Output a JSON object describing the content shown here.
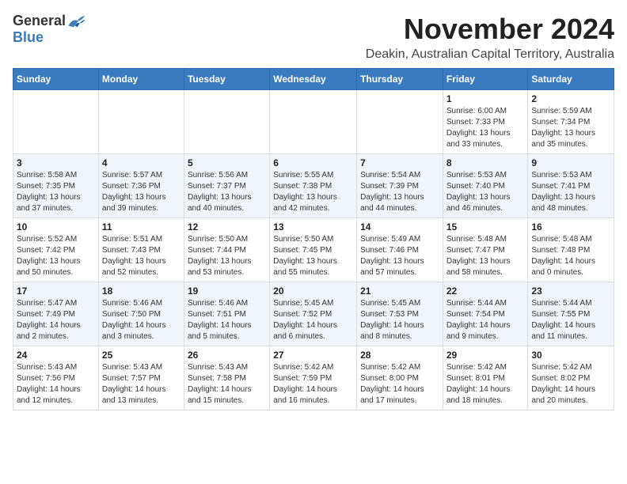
{
  "logo": {
    "general": "General",
    "blue": "Blue"
  },
  "title": "November 2024",
  "location": "Deakin, Australian Capital Territory, Australia",
  "days_header": [
    "Sunday",
    "Monday",
    "Tuesday",
    "Wednesday",
    "Thursday",
    "Friday",
    "Saturday"
  ],
  "weeks": [
    [
      {
        "day": "",
        "info": ""
      },
      {
        "day": "",
        "info": ""
      },
      {
        "day": "",
        "info": ""
      },
      {
        "day": "",
        "info": ""
      },
      {
        "day": "",
        "info": ""
      },
      {
        "day": "1",
        "info": "Sunrise: 6:00 AM\nSunset: 7:33 PM\nDaylight: 13 hours\nand 33 minutes."
      },
      {
        "day": "2",
        "info": "Sunrise: 5:59 AM\nSunset: 7:34 PM\nDaylight: 13 hours\nand 35 minutes."
      }
    ],
    [
      {
        "day": "3",
        "info": "Sunrise: 5:58 AM\nSunset: 7:35 PM\nDaylight: 13 hours\nand 37 minutes."
      },
      {
        "day": "4",
        "info": "Sunrise: 5:57 AM\nSunset: 7:36 PM\nDaylight: 13 hours\nand 39 minutes."
      },
      {
        "day": "5",
        "info": "Sunrise: 5:56 AM\nSunset: 7:37 PM\nDaylight: 13 hours\nand 40 minutes."
      },
      {
        "day": "6",
        "info": "Sunrise: 5:55 AM\nSunset: 7:38 PM\nDaylight: 13 hours\nand 42 minutes."
      },
      {
        "day": "7",
        "info": "Sunrise: 5:54 AM\nSunset: 7:39 PM\nDaylight: 13 hours\nand 44 minutes."
      },
      {
        "day": "8",
        "info": "Sunrise: 5:53 AM\nSunset: 7:40 PM\nDaylight: 13 hours\nand 46 minutes."
      },
      {
        "day": "9",
        "info": "Sunrise: 5:53 AM\nSunset: 7:41 PM\nDaylight: 13 hours\nand 48 minutes."
      }
    ],
    [
      {
        "day": "10",
        "info": "Sunrise: 5:52 AM\nSunset: 7:42 PM\nDaylight: 13 hours\nand 50 minutes."
      },
      {
        "day": "11",
        "info": "Sunrise: 5:51 AM\nSunset: 7:43 PM\nDaylight: 13 hours\nand 52 minutes."
      },
      {
        "day": "12",
        "info": "Sunrise: 5:50 AM\nSunset: 7:44 PM\nDaylight: 13 hours\nand 53 minutes."
      },
      {
        "day": "13",
        "info": "Sunrise: 5:50 AM\nSunset: 7:45 PM\nDaylight: 13 hours\nand 55 minutes."
      },
      {
        "day": "14",
        "info": "Sunrise: 5:49 AM\nSunset: 7:46 PM\nDaylight: 13 hours\nand 57 minutes."
      },
      {
        "day": "15",
        "info": "Sunrise: 5:48 AM\nSunset: 7:47 PM\nDaylight: 13 hours\nand 58 minutes."
      },
      {
        "day": "16",
        "info": "Sunrise: 5:48 AM\nSunset: 7:48 PM\nDaylight: 14 hours\nand 0 minutes."
      }
    ],
    [
      {
        "day": "17",
        "info": "Sunrise: 5:47 AM\nSunset: 7:49 PM\nDaylight: 14 hours\nand 2 minutes."
      },
      {
        "day": "18",
        "info": "Sunrise: 5:46 AM\nSunset: 7:50 PM\nDaylight: 14 hours\nand 3 minutes."
      },
      {
        "day": "19",
        "info": "Sunrise: 5:46 AM\nSunset: 7:51 PM\nDaylight: 14 hours\nand 5 minutes."
      },
      {
        "day": "20",
        "info": "Sunrise: 5:45 AM\nSunset: 7:52 PM\nDaylight: 14 hours\nand 6 minutes."
      },
      {
        "day": "21",
        "info": "Sunrise: 5:45 AM\nSunset: 7:53 PM\nDaylight: 14 hours\nand 8 minutes."
      },
      {
        "day": "22",
        "info": "Sunrise: 5:44 AM\nSunset: 7:54 PM\nDaylight: 14 hours\nand 9 minutes."
      },
      {
        "day": "23",
        "info": "Sunrise: 5:44 AM\nSunset: 7:55 PM\nDaylight: 14 hours\nand 11 minutes."
      }
    ],
    [
      {
        "day": "24",
        "info": "Sunrise: 5:43 AM\nSunset: 7:56 PM\nDaylight: 14 hours\nand 12 minutes."
      },
      {
        "day": "25",
        "info": "Sunrise: 5:43 AM\nSunset: 7:57 PM\nDaylight: 14 hours\nand 13 minutes."
      },
      {
        "day": "26",
        "info": "Sunrise: 5:43 AM\nSunset: 7:58 PM\nDaylight: 14 hours\nand 15 minutes."
      },
      {
        "day": "27",
        "info": "Sunrise: 5:42 AM\nSunset: 7:59 PM\nDaylight: 14 hours\nand 16 minutes."
      },
      {
        "day": "28",
        "info": "Sunrise: 5:42 AM\nSunset: 8:00 PM\nDaylight: 14 hours\nand 17 minutes."
      },
      {
        "day": "29",
        "info": "Sunrise: 5:42 AM\nSunset: 8:01 PM\nDaylight: 14 hours\nand 18 minutes."
      },
      {
        "day": "30",
        "info": "Sunrise: 5:42 AM\nSunset: 8:02 PM\nDaylight: 14 hours\nand 20 minutes."
      }
    ]
  ]
}
